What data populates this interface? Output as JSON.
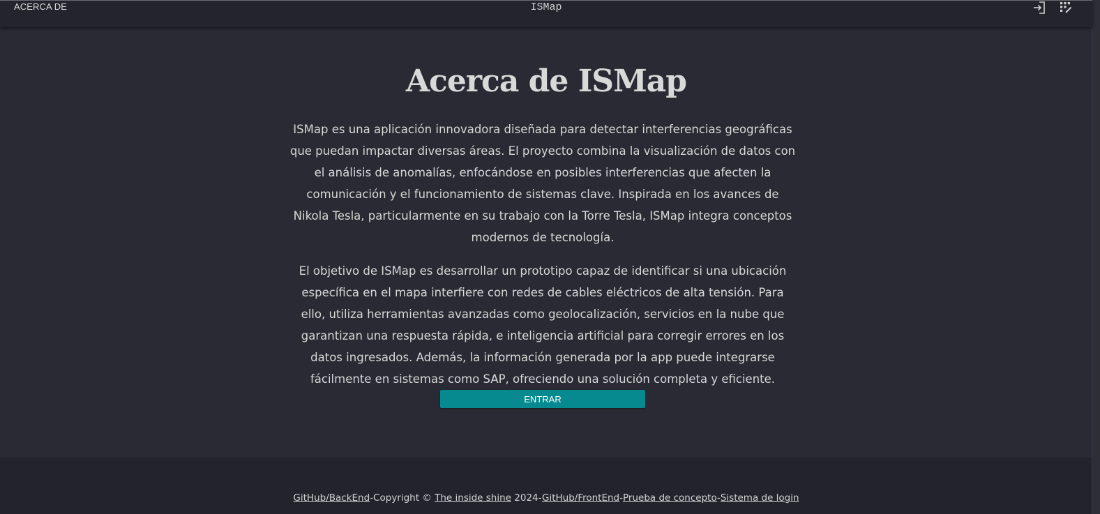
{
  "header": {
    "nav_label": "ACERCA DE",
    "app_title": "ISMap",
    "icons": [
      "login-icon",
      "apps-edit-icon"
    ]
  },
  "main": {
    "title": "Acerca de ISMap",
    "paragraphs": [
      "ISMap es una aplicación innovadora diseñada para detectar interferencias geográficas que puedan impactar diversas áreas. El proyecto combina la visualización de datos con el análisis de anomalías, enfocándose en posibles interferencias que afecten la comunicación y el funcionamiento de sistemas clave. Inspirada en los avances de Nikola Tesla, particularmente en su trabajo con la Torre Tesla, ISMap integra conceptos modernos de tecnología.",
      "El objetivo de ISMap es desarrollar un prototipo capaz de identificar si una ubicación específica en el mapa interfiere con redes de cables eléctricos de alta tensión. Para ello, utiliza herramientas avanzadas como geolocalización, servicios en la nube que garantizan una respuesta rápida, e inteligencia artificial para corregir errores en los datos ingresados. Además, la información generada por la app puede integrarse fácilmente en sistemas como SAP, ofreciendo una solución completa y eficiente."
    ],
    "enter_button": "ENTRAR"
  },
  "footer": {
    "link_backend": "GitHub/BackEnd",
    "copyright_prefix": "-Copyright © ",
    "link_company": "The inside shine",
    "year_suffix": " 2024-",
    "link_frontend": "GitHub/FrontEnd",
    "sep1": "-",
    "link_poc": "Prueba de concepto",
    "sep2": "-",
    "link_login": "Sistema de login"
  },
  "colors": {
    "background": "#292a33",
    "header_bg": "#23242c",
    "footer_bg": "#22232b",
    "accent_button": "#078a8f",
    "text": "#d8d8d8"
  }
}
